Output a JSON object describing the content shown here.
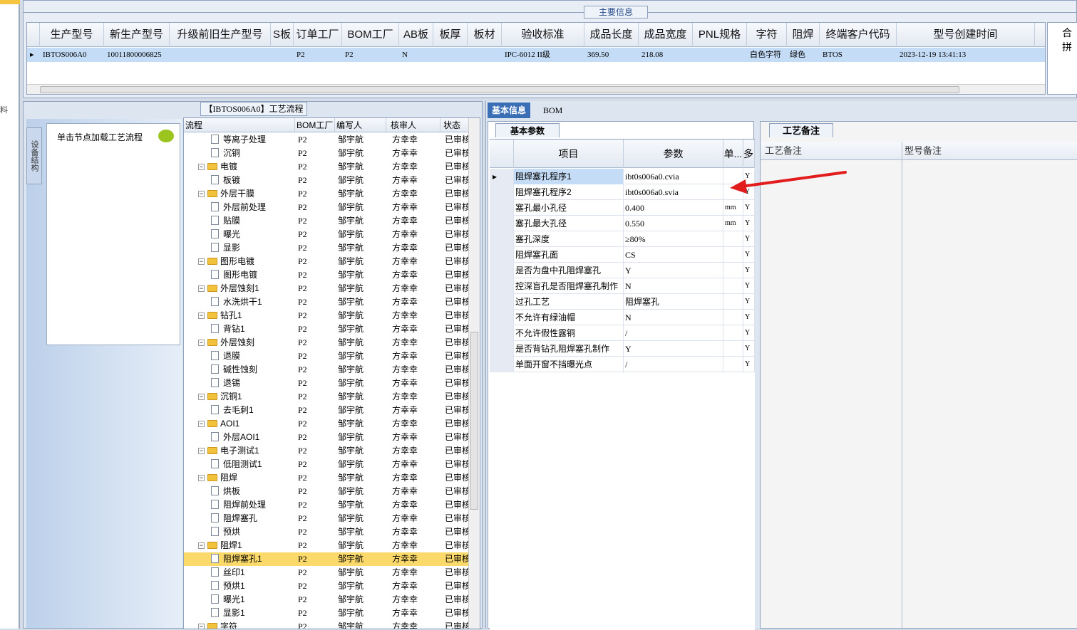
{
  "left_strip": {
    "char": "料"
  },
  "main_info": {
    "title": "主要信息",
    "columns": [
      "生产型号",
      "新生产型号",
      "升级前旧生产型号",
      "S板",
      "订单工厂",
      "BOM工厂",
      "AB板",
      "板厚",
      "板材",
      "验收标准",
      "成品长度",
      "成品宽度",
      "PNL规格",
      "字符",
      "阻焊",
      "终端客户代码",
      "型号创建时间"
    ],
    "row": [
      "IBTOS006A0",
      "10011800006825",
      "",
      "",
      "P2",
      "P2",
      "N",
      "",
      "",
      "IPC-6012 II级",
      "369.50",
      "218.08",
      "",
      "白色字符",
      "绿色",
      "BTOS",
      "2023-12-19 13:41:13"
    ],
    "extra_header": "合拼"
  },
  "process": {
    "title": "【IBTOS006A0】工艺流程",
    "side_tab": "设备结构",
    "side_hint": "单击节点加载工艺流程",
    "columns": [
      "流程",
      "BOM工厂",
      "编写人",
      "核审人",
      "状态"
    ],
    "rows": [
      {
        "name": "等离子处理",
        "kind": "doc",
        "bom": "P2",
        "writer": "邹宇航",
        "reviewer": "方幸幸",
        "status": "已审核"
      },
      {
        "name": "沉铜",
        "kind": "doc",
        "bom": "P2",
        "writer": "邹宇航",
        "reviewer": "方幸幸",
        "status": "已审核"
      },
      {
        "name": "电镀",
        "kind": "folder",
        "bom": "P2",
        "writer": "邹宇航",
        "reviewer": "方幸幸",
        "status": "已审核"
      },
      {
        "name": "板镀",
        "kind": "doc",
        "bom": "P2",
        "writer": "邹宇航",
        "reviewer": "方幸幸",
        "status": "已审核"
      },
      {
        "name": "外层干膜",
        "kind": "folder",
        "bom": "P2",
        "writer": "邹宇航",
        "reviewer": "方幸幸",
        "status": "已审核"
      },
      {
        "name": "外层前处理",
        "kind": "doc",
        "bom": "P2",
        "writer": "邹宇航",
        "reviewer": "方幸幸",
        "status": "已审核"
      },
      {
        "name": "贴膜",
        "kind": "doc",
        "bom": "P2",
        "writer": "邹宇航",
        "reviewer": "方幸幸",
        "status": "已审核"
      },
      {
        "name": "曝光",
        "kind": "doc",
        "bom": "P2",
        "writer": "邹宇航",
        "reviewer": "方幸幸",
        "status": "已审核"
      },
      {
        "name": "显影",
        "kind": "doc",
        "bom": "P2",
        "writer": "邹宇航",
        "reviewer": "方幸幸",
        "status": "已审核"
      },
      {
        "name": "图形电镀",
        "kind": "folder",
        "bom": "P2",
        "writer": "邹宇航",
        "reviewer": "方幸幸",
        "status": "已审核"
      },
      {
        "name": "图形电镀",
        "kind": "doc",
        "bom": "P2",
        "writer": "邹宇航",
        "reviewer": "方幸幸",
        "status": "已审核"
      },
      {
        "name": "外层蚀刻1",
        "kind": "folder",
        "bom": "P2",
        "writer": "邹宇航",
        "reviewer": "方幸幸",
        "status": "已审核"
      },
      {
        "name": "水洗烘干1",
        "kind": "doc",
        "bom": "P2",
        "writer": "邹宇航",
        "reviewer": "方幸幸",
        "status": "已审核"
      },
      {
        "name": "钻孔1",
        "kind": "folder",
        "bom": "P2",
        "writer": "邹宇航",
        "reviewer": "方幸幸",
        "status": "已审核"
      },
      {
        "name": "背钻1",
        "kind": "doc",
        "bom": "P2",
        "writer": "邹宇航",
        "reviewer": "方幸幸",
        "status": "已审核"
      },
      {
        "name": "外层蚀刻",
        "kind": "folder",
        "bom": "P2",
        "writer": "邹宇航",
        "reviewer": "方幸幸",
        "status": "已审核"
      },
      {
        "name": "退膜",
        "kind": "doc",
        "bom": "P2",
        "writer": "邹宇航",
        "reviewer": "方幸幸",
        "status": "已审核"
      },
      {
        "name": "碱性蚀刻",
        "kind": "doc",
        "bom": "P2",
        "writer": "邹宇航",
        "reviewer": "方幸幸",
        "status": "已审核"
      },
      {
        "name": "退锡",
        "kind": "doc",
        "bom": "P2",
        "writer": "邹宇航",
        "reviewer": "方幸幸",
        "status": "已审核"
      },
      {
        "name": "沉铜1",
        "kind": "folder",
        "bom": "P2",
        "writer": "邹宇航",
        "reviewer": "方幸幸",
        "status": "已审核"
      },
      {
        "name": "去毛刺1",
        "kind": "doc",
        "bom": "P2",
        "writer": "邹宇航",
        "reviewer": "方幸幸",
        "status": "已审核"
      },
      {
        "name": "AOI1",
        "kind": "folder",
        "bom": "P2",
        "writer": "邹宇航",
        "reviewer": "方幸幸",
        "status": "已审核"
      },
      {
        "name": "外层AOI1",
        "kind": "doc",
        "bom": "P2",
        "writer": "邹宇航",
        "reviewer": "方幸幸",
        "status": "已审核"
      },
      {
        "name": "电子测试1",
        "kind": "folder",
        "bom": "P2",
        "writer": "邹宇航",
        "reviewer": "方幸幸",
        "status": "已审核"
      },
      {
        "name": "低阻测试1",
        "kind": "doc",
        "bom": "P2",
        "writer": "邹宇航",
        "reviewer": "方幸幸",
        "status": "已审核"
      },
      {
        "name": "阻焊",
        "kind": "folder",
        "bom": "P2",
        "writer": "邹宇航",
        "reviewer": "方幸幸",
        "status": "已审核"
      },
      {
        "name": "烘板",
        "kind": "doc",
        "bom": "P2",
        "writer": "邹宇航",
        "reviewer": "方幸幸",
        "status": "已审核"
      },
      {
        "name": "阻焊前处理",
        "kind": "doc",
        "bom": "P2",
        "writer": "邹宇航",
        "reviewer": "方幸幸",
        "status": "已审核"
      },
      {
        "name": "阻焊塞孔",
        "kind": "doc",
        "bom": "P2",
        "writer": "邹宇航",
        "reviewer": "方幸幸",
        "status": "已审核"
      },
      {
        "name": "预烘",
        "kind": "doc",
        "bom": "P2",
        "writer": "邹宇航",
        "reviewer": "方幸幸",
        "status": "已审核"
      },
      {
        "name": "阻焊1",
        "kind": "folder",
        "bom": "P2",
        "writer": "邹宇航",
        "reviewer": "方幸幸",
        "status": "已审核"
      },
      {
        "name": "阻焊塞孔1",
        "kind": "doc",
        "bom": "P2",
        "writer": "邹宇航",
        "reviewer": "方幸幸",
        "status": "已审核",
        "selected": true
      },
      {
        "name": "丝印1",
        "kind": "doc",
        "bom": "P2",
        "writer": "邹宇航",
        "reviewer": "方幸幸",
        "status": "已审核"
      },
      {
        "name": "预烘1",
        "kind": "doc",
        "bom": "P2",
        "writer": "邹宇航",
        "reviewer": "方幸幸",
        "status": "已审核"
      },
      {
        "name": "曝光1",
        "kind": "doc",
        "bom": "P2",
        "writer": "邹宇航",
        "reviewer": "方幸幸",
        "status": "已审核"
      },
      {
        "name": "显影1",
        "kind": "doc",
        "bom": "P2",
        "writer": "邹宇航",
        "reviewer": "方幸幸",
        "status": "已审核"
      },
      {
        "name": "字符",
        "kind": "folder",
        "bom": "P2",
        "writer": "邹宇航",
        "reviewer": "方幸幸",
        "status": "已审核"
      }
    ]
  },
  "right_tabs": [
    "基本信息",
    "BOM"
  ],
  "basic_params": {
    "title": "基本参数",
    "columns": [
      "项目",
      "参数",
      "单...",
      "多."
    ],
    "rows": [
      {
        "item": "阻焊塞孔程序1",
        "param": "ibt0s006a0.cvia",
        "unit": "",
        "flag": "Y"
      },
      {
        "item": "阻焊塞孔程序2",
        "param": "ibt0s006a0.svia",
        "unit": "",
        "flag": "Y"
      },
      {
        "item": "塞孔最小孔径",
        "param": "0.400",
        "unit": "mm",
        "flag": "Y"
      },
      {
        "item": "塞孔最大孔径",
        "param": "0.550",
        "unit": "mm",
        "flag": "Y"
      },
      {
        "item": "塞孔深度",
        "param": "≥80%",
        "unit": "",
        "flag": "Y"
      },
      {
        "item": "阻焊塞孔面",
        "param": "CS",
        "unit": "",
        "flag": "Y"
      },
      {
        "item": "是否为盘中孔阻焊塞孔",
        "param": "Y",
        "unit": "",
        "flag": "Y"
      },
      {
        "item": "控深盲孔是否阻焊塞孔制作",
        "param": "N",
        "unit": "",
        "flag": "Y"
      },
      {
        "item": "过孔工艺",
        "param": "阻焊塞孔",
        "unit": "",
        "flag": "Y"
      },
      {
        "item": "不允许有绿油帽",
        "param": "N",
        "unit": "",
        "flag": "Y"
      },
      {
        "item": "不允许假性露铜",
        "param": "/",
        "unit": "",
        "flag": "Y"
      },
      {
        "item": "是否背钻孔阻焊塞孔制作",
        "param": "Y",
        "unit": "",
        "flag": "Y"
      },
      {
        "item": "单面开窗不挡曝光点",
        "param": "/",
        "unit": "",
        "flag": "Y"
      }
    ]
  },
  "process_notes": {
    "title": "工艺备注",
    "col1": "工艺备注",
    "col2": "型号备注"
  },
  "colors": {
    "accent": "#3b6fb5",
    "selected_row": "#fbd96a",
    "highlight_row": "#c4dcf6",
    "arrow": "#e21c1c"
  }
}
